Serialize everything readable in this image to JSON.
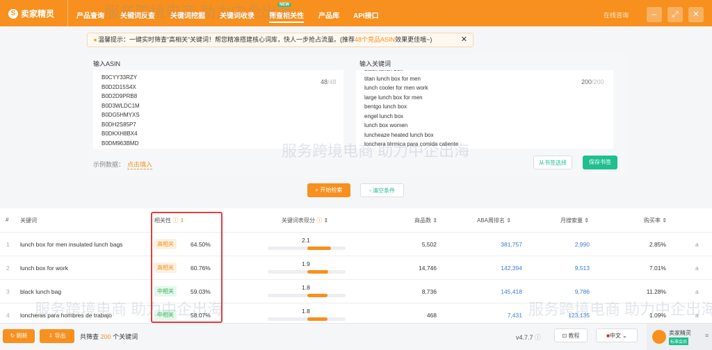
{
  "header": {
    "logo": "卖家精灵",
    "nav": [
      {
        "label": "产品查询"
      },
      {
        "label": "关键词反查"
      },
      {
        "label": "关键词挖掘"
      },
      {
        "label": "关键词收录"
      },
      {
        "label": "筛查相关性",
        "active": true,
        "badge": "NEW"
      },
      {
        "label": "产品库"
      },
      {
        "label": "API接口"
      }
    ],
    "consult": "在线咨询"
  },
  "tip": {
    "prefix": "温馨提示：一键实时筛查“高相关”关键词！帮您精准搭建核心词库，快人一步抢占流量。(推荐",
    "highlight": "48个竞品ASIN",
    "suffix": "效果更佳哦~)"
  },
  "asin": {
    "label": "输入ASIN",
    "items": [
      "B0CYY33RZY",
      "B0D2D15S4X",
      "B0D2D9PRB8",
      "B0D3WLDC1M",
      "B0DG5HMYXS",
      "B0DH2S85P7",
      "B0DKXH8BX4",
      "B0DM963BMD"
    ],
    "count": "48",
    "max": "/48"
  },
  "keywords": {
    "label": "输入关键词",
    "items": [
      "black lunch box",
      "titan lunch box for men",
      "lunch cooler for men work",
      "large lunch box for men",
      "bentgo lunch box",
      "engel lunch box",
      "lunch box women",
      "luncheaze heated lunch box",
      "lonchera térmica para comida caliente"
    ],
    "count": "200",
    "max": "/200"
  },
  "sample": {
    "label": "示例数据：",
    "link": "点击填入"
  },
  "buttons": {
    "from_bookmark": "从书签选择",
    "save_bookmark": "保存书签",
    "search": "开始检索",
    "clear": "清空条件"
  },
  "table": {
    "headers": [
      "#",
      "关键词",
      "相关性",
      "关键词表现分",
      "商品数",
      "ABA周排名",
      "月搜索量",
      "购买率"
    ],
    "rows": [
      {
        "n": "1",
        "kw": "lunch box for men insulated lunch bags",
        "tag": "高相关",
        "level": "hi",
        "rel": "64.50%",
        "score": "2.1",
        "products": "5,502",
        "aba": "381,757",
        "search": "2,990",
        "rate": "2.85%"
      },
      {
        "n": "2",
        "kw": "lunch box for work",
        "tag": "高相关",
        "level": "hi",
        "rel": "60.76%",
        "score": "1.9",
        "products": "14,746",
        "aba": "142,394",
        "search": "9,513",
        "rate": "7.01%"
      },
      {
        "n": "3",
        "kw": "black lunch bag",
        "tag": "中相关",
        "level": "mid",
        "rel": "59.03%",
        "score": "1.8",
        "products": "8,736",
        "aba": "145,418",
        "search": "9,786",
        "rate": "11.28%"
      },
      {
        "n": "4",
        "kw": "loncheras para hombres de trabajo",
        "tag": "中相关",
        "level": "mid",
        "rel": "58.07%",
        "score": "1.8",
        "products": "468",
        "aba": "7,431",
        "search": "123,135",
        "rate": "1.09%"
      }
    ]
  },
  "footer": {
    "refresh": "刷新",
    "export": "导出",
    "total_prefix": "共筛查",
    "total": "200",
    "total_suffix": "个关键词",
    "version": "v4.7.7",
    "tutorial": "教程",
    "language": "中文",
    "brand": "卖家精灵",
    "brand_badge": "标准会员"
  },
  "watermark": "服务跨境电商 助力中企出海",
  "colors": {
    "accent": "#f7901e",
    "green": "#1fbf8f",
    "blue": "#3a7bd5"
  }
}
